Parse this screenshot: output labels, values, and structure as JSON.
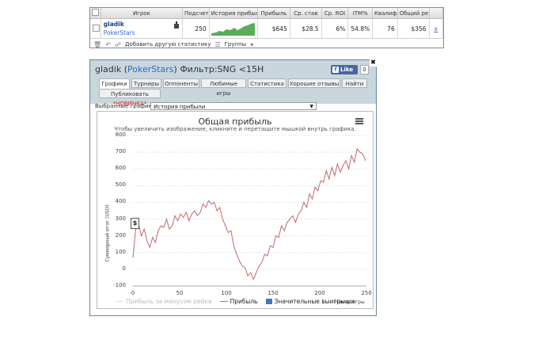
{
  "stats": {
    "headers": [
      "Игрок",
      "Подсчет",
      "История прибыл",
      "Прибыль",
      "Ср. став",
      "Ср. ROI",
      "ITM%",
      "Квалиф",
      "Общий ре"
    ],
    "row": {
      "name": "gladik",
      "site": "PokerStars",
      "count": "250",
      "profit": "$645",
      "avg_stake": "$28.5",
      "avg_roi": "6%",
      "itm": "54.8%",
      "qualif": "76",
      "total": "$356",
      "remove": "x"
    },
    "footer": {
      "add_label": "Добавить другую статистику",
      "groups_label": "Группы"
    }
  },
  "window": {
    "player": "gladik",
    "site": "PokerStars",
    "filter": "Фильтр:SNG <15H",
    "fb_label": "Like",
    "fb_count": "0",
    "tabs": [
      "Графики",
      "Турниры",
      "Оппоненты",
      "Любимые игры",
      "Статистика",
      "Хорошие отзывы",
      "Найти"
    ],
    "publish_tab": "Публиковать",
    "publish_new": "*НОВИНКА*",
    "selector_label": "Выбранные графики:",
    "selector_value": "История прибыли"
  },
  "colors": {
    "profit_line": "#c0696b",
    "rake_line": "#dddddd",
    "significant": "#3b78c4",
    "header_bg": "#c9d6de"
  },
  "chart_data": {
    "type": "line",
    "title": "Общая прибыль",
    "subtitle": "Чтобы увеличить изображение, кликните и перетащите мышкой внутрь графика.",
    "ylabel": "Суммарный итог (USD)",
    "xlabel": "Номер игры",
    "xlim": [
      0,
      250
    ],
    "ylim": [
      -100,
      800
    ],
    "xticks": [
      0,
      50,
      100,
      150,
      200,
      250
    ],
    "yticks": [
      -100,
      0,
      100,
      200,
      300,
      400,
      500,
      600,
      700,
      800
    ],
    "legend": [
      "Прибыль за минусом рейка",
      "Прибыль",
      "Значительные выигрыши"
    ],
    "series": [
      {
        "name": "Прибыль",
        "points": [
          [
            0,
            70
          ],
          [
            3,
            240
          ],
          [
            6,
            270
          ],
          [
            9,
            200
          ],
          [
            12,
            240
          ],
          [
            15,
            170
          ],
          [
            18,
            130
          ],
          [
            21,
            190
          ],
          [
            24,
            160
          ],
          [
            27,
            230
          ],
          [
            30,
            260
          ],
          [
            33,
            250
          ],
          [
            36,
            300
          ],
          [
            39,
            240
          ],
          [
            42,
            260
          ],
          [
            45,
            320
          ],
          [
            48,
            290
          ],
          [
            51,
            330
          ],
          [
            54,
            310
          ],
          [
            57,
            340
          ],
          [
            60,
            290
          ],
          [
            63,
            330
          ],
          [
            66,
            350
          ],
          [
            69,
            320
          ],
          [
            72,
            340
          ],
          [
            75,
            390
          ],
          [
            78,
            370
          ],
          [
            81,
            410
          ],
          [
            84,
            390
          ],
          [
            87,
            400
          ],
          [
            90,
            350
          ],
          [
            93,
            370
          ],
          [
            96,
            300
          ],
          [
            99,
            260
          ],
          [
            102,
            220
          ],
          [
            105,
            230
          ],
          [
            108,
            140
          ],
          [
            111,
            90
          ],
          [
            114,
            50
          ],
          [
            117,
            20
          ],
          [
            120,
            10
          ],
          [
            123,
            -40
          ],
          [
            126,
            -20
          ],
          [
            129,
            -60
          ],
          [
            132,
            -20
          ],
          [
            135,
            20
          ],
          [
            138,
            40
          ],
          [
            141,
            90
          ],
          [
            144,
            80
          ],
          [
            147,
            140
          ],
          [
            150,
            130
          ],
          [
            153,
            200
          ],
          [
            156,
            190
          ],
          [
            159,
            260
          ],
          [
            162,
            230
          ],
          [
            165,
            280
          ],
          [
            168,
            300
          ],
          [
            171,
            320
          ],
          [
            174,
            280
          ],
          [
            177,
            330
          ],
          [
            180,
            350
          ],
          [
            183,
            400
          ],
          [
            186,
            370
          ],
          [
            189,
            450
          ],
          [
            192,
            420
          ],
          [
            195,
            490
          ],
          [
            198,
            470
          ],
          [
            201,
            530
          ],
          [
            204,
            520
          ],
          [
            207,
            590
          ],
          [
            210,
            540
          ],
          [
            213,
            610
          ],
          [
            216,
            560
          ],
          [
            219,
            630
          ],
          [
            222,
            580
          ],
          [
            225,
            620
          ],
          [
            228,
            650
          ],
          [
            231,
            600
          ],
          [
            234,
            680
          ],
          [
            237,
            640
          ],
          [
            240,
            720
          ],
          [
            243,
            700
          ],
          [
            246,
            690
          ],
          [
            249,
            650
          ]
        ]
      }
    ]
  }
}
